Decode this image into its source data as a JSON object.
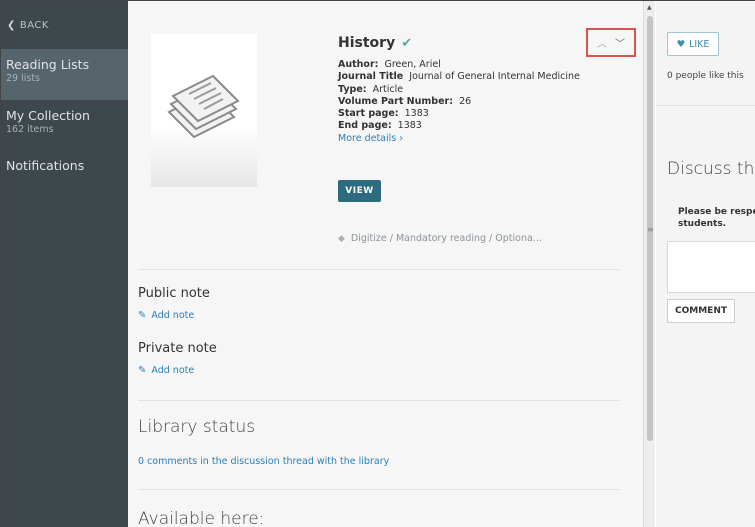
{
  "sidebar": {
    "back_label": "BACK",
    "items": [
      {
        "title": "Reading Lists",
        "count": "29 lists"
      },
      {
        "title": "My Collection",
        "count": "162 items"
      },
      {
        "title": "Notifications",
        "count": ""
      }
    ]
  },
  "item": {
    "title": "History",
    "author_label": "Author:",
    "author_value": "Green, Ariel",
    "journal_label": "Journal Title",
    "journal_value": "Journal of General Internal Medicine",
    "type_label": "Type:",
    "type_value": "Article",
    "volume_label": "Volume Part Number:",
    "volume_value": "26",
    "start_label": "Start page:",
    "start_value": "1383",
    "end_label": "End page:",
    "end_value": "1383",
    "more_details": "More details ›",
    "view_label": "VIEW",
    "tags": "Digitize / Mandatory reading / Optiona..."
  },
  "notes": {
    "public_heading": "Public note",
    "public_add": "Add note",
    "private_heading": "Private note",
    "private_add": "Add note"
  },
  "library": {
    "heading": "Library status",
    "link": "0 comments in the discussion thread with the library",
    "available_heading": "Available here:"
  },
  "right": {
    "like_label": "LIKE",
    "like_count": "0 people like this",
    "discuss_heading": "Discuss this",
    "respect_line1": "Please be respec",
    "respect_line2": "students.",
    "comment_label": "COMMENT"
  },
  "icons": {
    "back": "chevron-left-icon",
    "verified": "check-icon",
    "prev": "chevron-up-icon",
    "next": "chevron-down-icon",
    "tag": "tag-icon",
    "pencil": "pencil-icon",
    "heart": "heart-icon"
  },
  "colors": {
    "sidebar_bg": "#3e474c",
    "sidebar_active": "#56646b",
    "accent_link": "#2c7fb8",
    "view_button": "#2e6b7e",
    "highlight_box": "#d9534f"
  }
}
